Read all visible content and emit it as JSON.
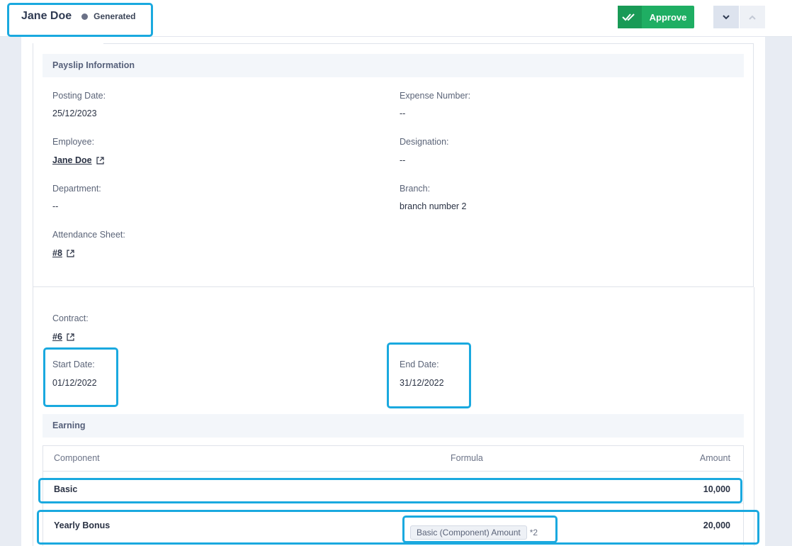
{
  "header": {
    "employee_name": "Jane Doe",
    "status": "Generated",
    "approve_label": "Approve"
  },
  "payslip": {
    "section_title": "Payslip Information",
    "posting_date_label": "Posting Date:",
    "posting_date": "25/12/2023",
    "expense_number_label": "Expense Number:",
    "expense_number": "--",
    "employee_label": "Employee:",
    "employee": "Jane Doe",
    "designation_label": "Designation:",
    "designation": "--",
    "department_label": "Department:",
    "department": "--",
    "branch_label": "Branch:",
    "branch": "branch number 2",
    "attendance_label": "Attendance Sheet:",
    "attendance": "#8"
  },
  "contract": {
    "contract_label": "Contract:",
    "contract": "#6",
    "start_label": "Start Date:",
    "start_date": "01/12/2022",
    "end_label": "End Date:",
    "end_date": "31/12/2022"
  },
  "earning": {
    "section_title": "Earning",
    "columns": {
      "component": "Component",
      "formula": "Formula",
      "amount": "Amount"
    },
    "rows": [
      {
        "component": "Basic",
        "formula_chip": "",
        "formula_suffix": "",
        "amount": "10,000"
      },
      {
        "component": "Yearly Bonus",
        "formula_chip": "Basic (Component) Amount",
        "formula_suffix": "*2",
        "amount": "20,000"
      }
    ]
  },
  "colors": {
    "approve": "#1fae63",
    "highlight": "#1aa9df",
    "status_dot": "#6b7187"
  }
}
